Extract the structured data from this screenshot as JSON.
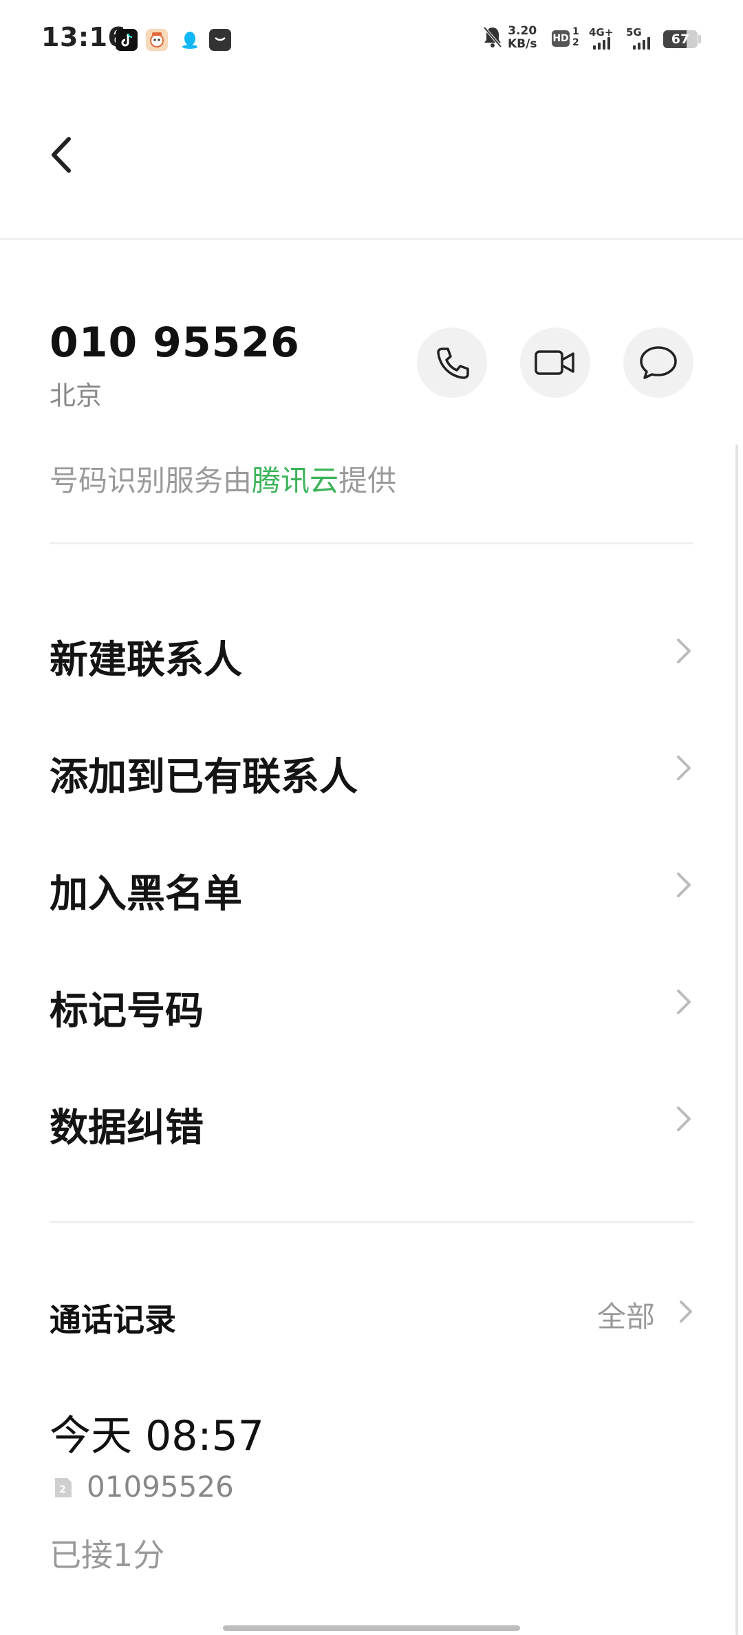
{
  "status_bar": {
    "time": "13:16",
    "net_speed_value": "3.20",
    "net_speed_unit": "KB/s",
    "hd_label": "HD",
    "sim_slots": "1\n2",
    "sim1_network": "4G+",
    "sim2_network": "5G",
    "battery_percent": "67",
    "battery_level": 0.67,
    "icons": [
      "tiktok-icon",
      "app-mascot-icon",
      "qq-penguin-icon",
      "message-bag-icon",
      "bell-muted-icon"
    ]
  },
  "header": {
    "back_icon": "chevron-left-icon"
  },
  "caller": {
    "number": "010 95526",
    "location": "北京",
    "provider_prefix": "号码识别服务由",
    "provider_brand": "腾讯云",
    "provider_suffix": "提供",
    "brand_color": "#3db35a"
  },
  "actions": [
    {
      "name": "call",
      "icon": "phone-icon"
    },
    {
      "name": "video-call",
      "icon": "video-camera-icon"
    },
    {
      "name": "message",
      "icon": "chat-bubble-icon"
    }
  ],
  "menu": {
    "items": [
      {
        "label": "新建联系人"
      },
      {
        "label": "添加到已有联系人"
      },
      {
        "label": "加入黑名单"
      },
      {
        "label": "标记号码"
      },
      {
        "label": "数据纠错"
      }
    ]
  },
  "call_log": {
    "title": "通话记录",
    "all_label": "全部",
    "entries": [
      {
        "time": "今天 08:57",
        "sim_badge": "2",
        "number": "01095526",
        "status": "已接1分"
      }
    ]
  }
}
